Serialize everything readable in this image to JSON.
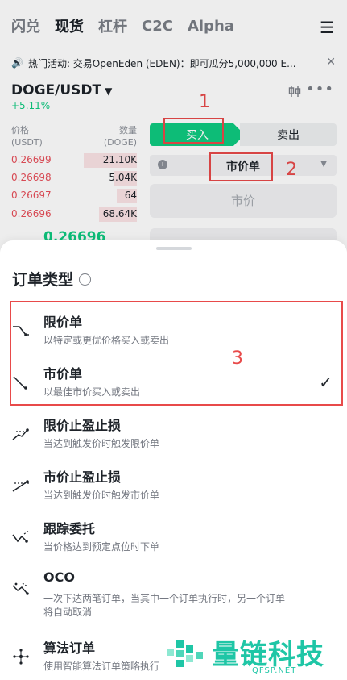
{
  "topnav": {
    "tabs": [
      "闪兑",
      "现货",
      "杠杆",
      "C2C",
      "Alpha"
    ],
    "active_index": 1,
    "menu_icon": "hamburger-icon"
  },
  "announcement": {
    "text": "热门活动: 交易OpenEden (EDEN)：即可瓜分5,000,000 E...",
    "icon": "speaker-icon",
    "close_icon": "close-icon"
  },
  "pair": {
    "symbol": "DOGE/USDT",
    "change": "+5.11%"
  },
  "orderbook": {
    "price_header": "价格",
    "price_unit": "(USDT)",
    "qty_header": "数量",
    "qty_unit": "(DOGE)",
    "asks": [
      {
        "price": "0.26699",
        "qty": "21.10K",
        "depth": 0.42
      },
      {
        "price": "0.26698",
        "qty": "5.04K",
        "depth": 0.18
      },
      {
        "price": "0.26697",
        "qty": "64",
        "depth": 0.16
      },
      {
        "price": "0.26696",
        "qty": "68.64K",
        "depth": 0.3
      }
    ],
    "last_price": "0.26696"
  },
  "order_form": {
    "buy_label": "买入",
    "sell_label": "卖出",
    "order_type": "市价单",
    "market_placeholder": "市价"
  },
  "annotations": {
    "n1": "1",
    "n2": "2",
    "n3": "3"
  },
  "sheet": {
    "title": "订单类型",
    "options": [
      {
        "name": "限价单",
        "desc": "以特定或更优价格买入或卖出",
        "icon": "limit-order-icon"
      },
      {
        "name": "市价单",
        "desc": "以最佳市价买入或卖出",
        "icon": "market-order-icon",
        "selected": true
      },
      {
        "name": "限价止盈止损",
        "desc": "当达到触发价时触发限价单",
        "icon": "stop-limit-icon"
      },
      {
        "name": "市价止盈止损",
        "desc": "当达到触发价时触发市价单",
        "icon": "stop-market-icon"
      },
      {
        "name": "跟踪委托",
        "desc": "当价格达到预定点位时下单",
        "icon": "trailing-stop-icon"
      },
      {
        "name": "OCO",
        "desc": "一次下达两笔订单，当其中一个订单执行时，另一个订单",
        "desc2": "将自动取消",
        "icon": "oco-icon"
      },
      {
        "name": "算法订单",
        "desc": "使用智能算法订单策略执行",
        "icon": "algo-order-icon"
      }
    ]
  },
  "watermark": {
    "text": "量链科技",
    "url": "QFSP.NET"
  },
  "colors": {
    "green": "#0ecb81",
    "red": "#e8505b",
    "annotation": "#e84a4a",
    "watermark": "#1fc6a6"
  }
}
